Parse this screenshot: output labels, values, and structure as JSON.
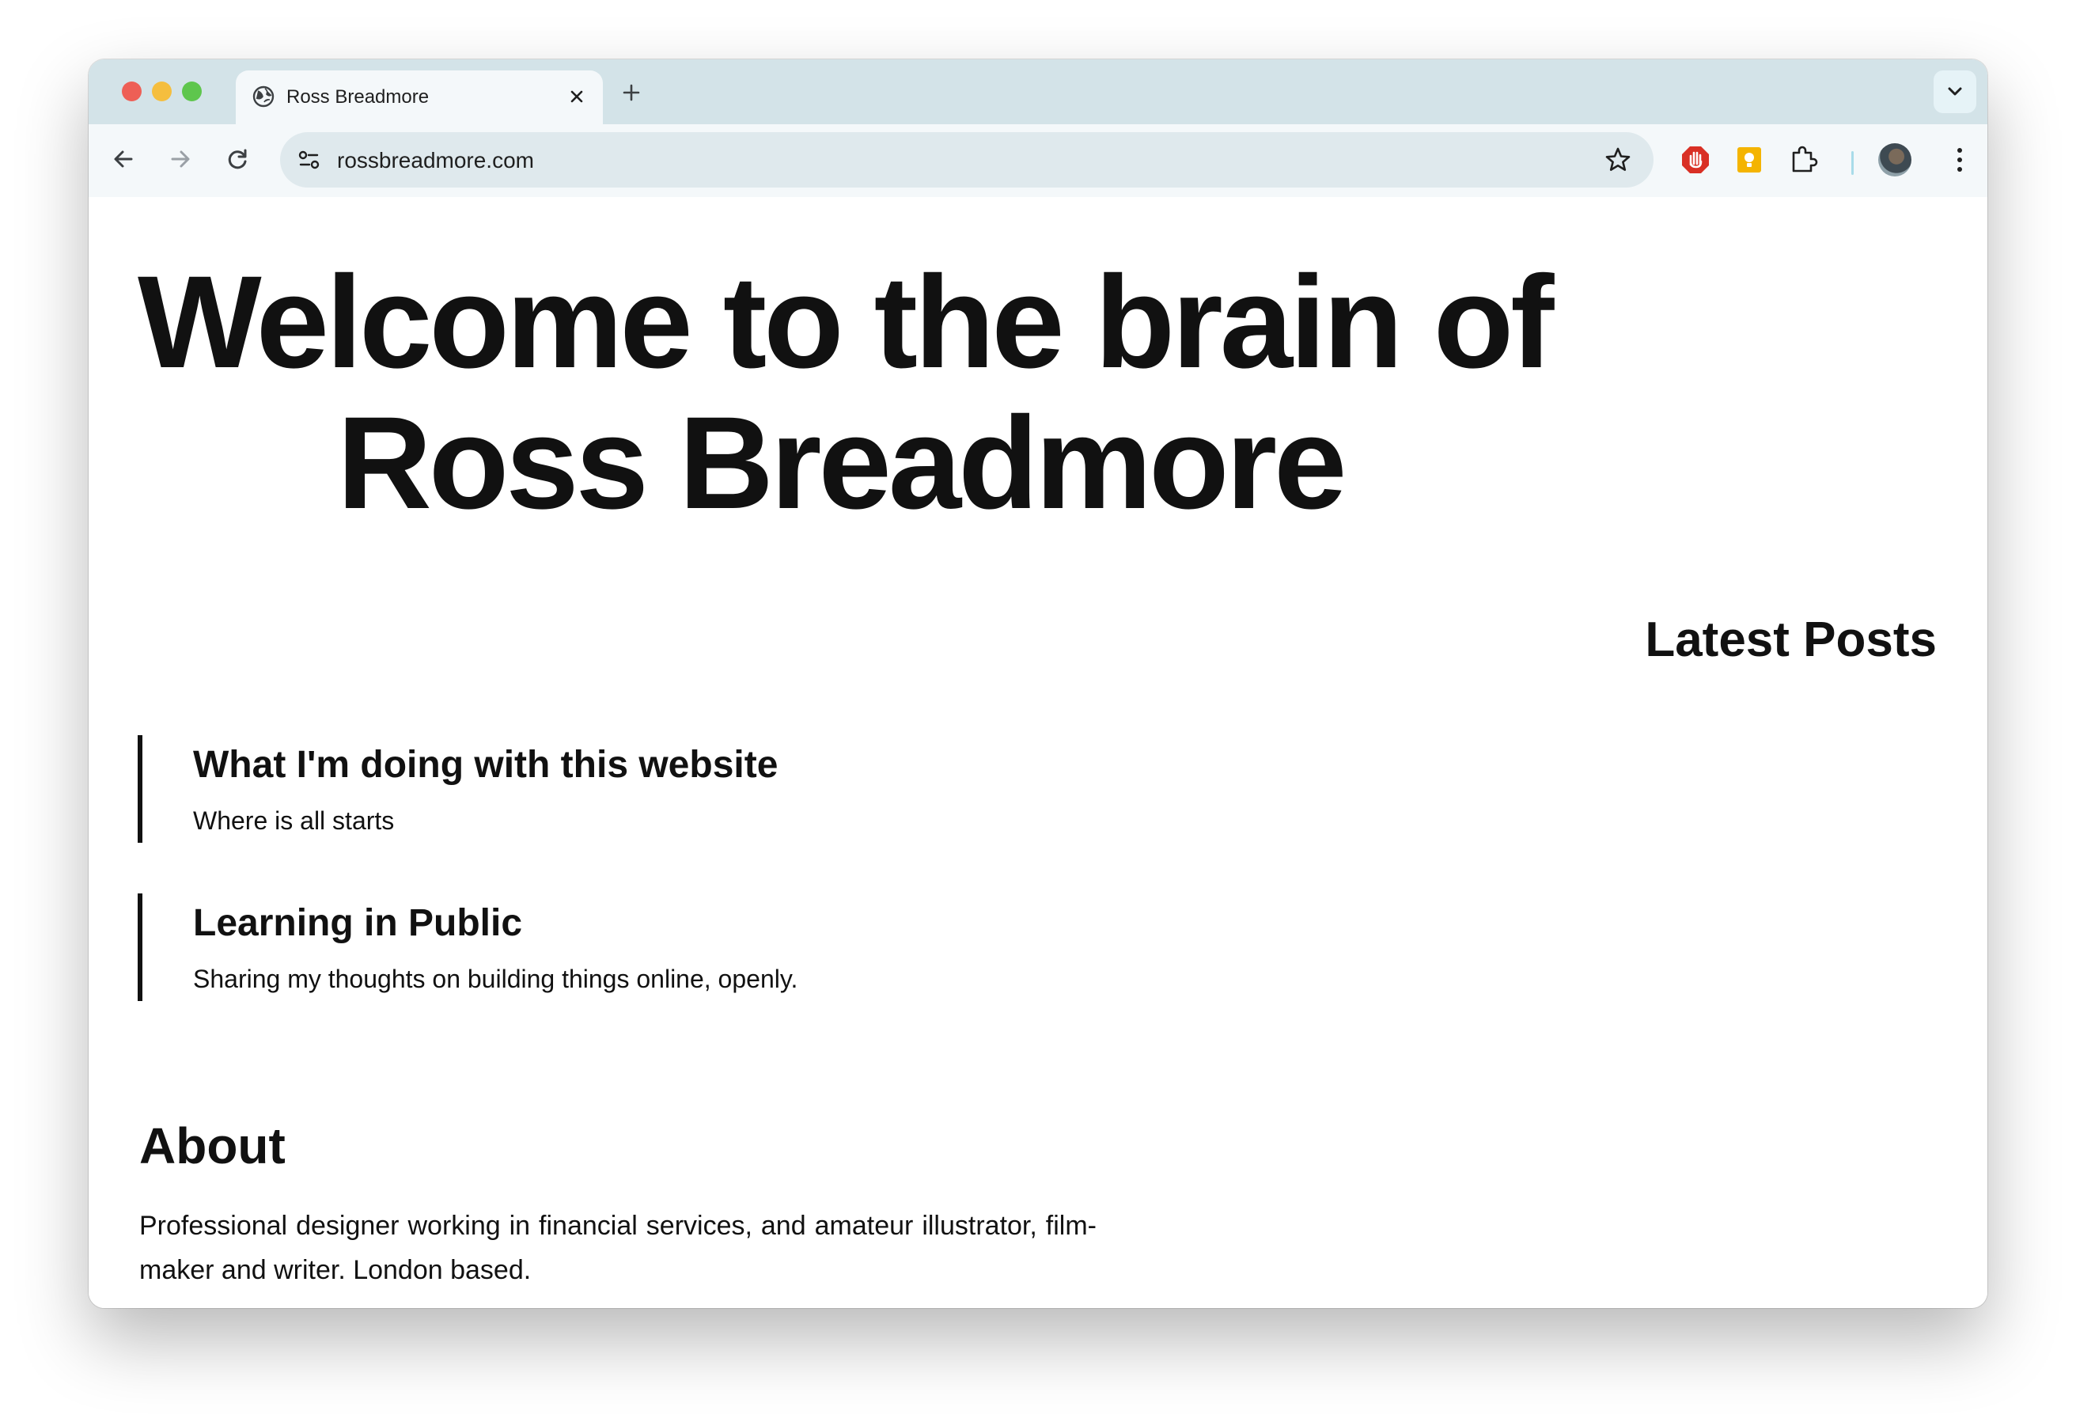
{
  "browser": {
    "tab": {
      "title": "Ross Breadmore"
    },
    "address_bar": {
      "url": "rossbreadmore.com"
    }
  },
  "page": {
    "hero": {
      "line1": "Welcome to the brain of",
      "line2": "Ross Breadmore"
    },
    "latest_posts": {
      "heading": "Latest Posts",
      "items": [
        {
          "title": "What I'm doing with this website",
          "subtitle": "Where is all starts"
        },
        {
          "title": "Learning in Public",
          "subtitle": "Sharing my thoughts on building things online, openly."
        }
      ]
    },
    "about": {
      "heading": "About",
      "text": "Professional designer working in financial services, and amateur illustrator, film-maker and writer. London based."
    }
  },
  "colors": {
    "tabstrip": "#d3e3e8",
    "text": "#111111",
    "adblock": "#d93025",
    "ext_yellow": "#f4b400"
  }
}
